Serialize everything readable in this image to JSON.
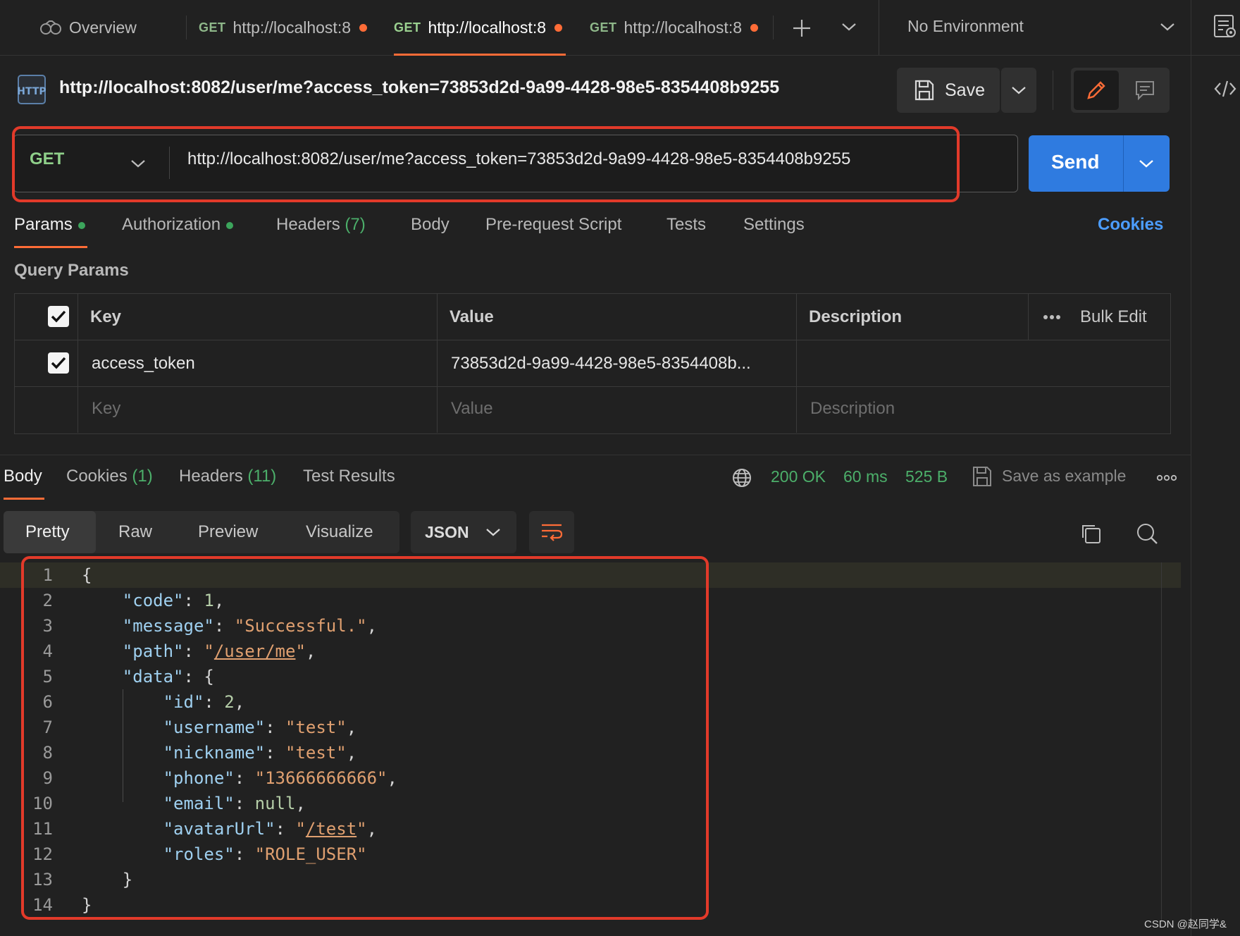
{
  "tabs": {
    "overview": "Overview",
    "items": [
      {
        "method": "GET",
        "label": "http://localhost:8"
      },
      {
        "method": "GET",
        "label": "http://localhost:8"
      },
      {
        "method": "GET",
        "label": "http://localhost:8"
      }
    ],
    "environment": "No Environment"
  },
  "request": {
    "title": "http://localhost:8082/user/me?access_token=73853d2d-9a99-4428-98e5-8354408b9255",
    "save_label": "Save",
    "method": "GET",
    "url": "http://localhost:8082/user/me?access_token=73853d2d-9a99-4428-98e5-8354408b9255",
    "send_label": "Send"
  },
  "request_tabs": {
    "params": "Params",
    "authorization": "Authorization",
    "headers": "Headers",
    "headers_count": "(7)",
    "body": "Body",
    "prerequest": "Pre-request Script",
    "tests": "Tests",
    "settings": "Settings",
    "cookies": "Cookies"
  },
  "query_params": {
    "section_title": "Query Params",
    "headers": {
      "key": "Key",
      "value": "Value",
      "description": "Description",
      "bulk_edit": "Bulk Edit"
    },
    "rows": [
      {
        "key": "access_token",
        "value": "73853d2d-9a99-4428-98e5-8354408b..."
      }
    ],
    "placeholders": {
      "key": "Key",
      "value": "Value",
      "description": "Description"
    }
  },
  "response": {
    "tabs": {
      "body": "Body",
      "cookies": "Cookies",
      "cookies_count": "(1)",
      "headers": "Headers",
      "headers_count": "(11)",
      "test_results": "Test Results"
    },
    "status": "200 OK",
    "time": "60 ms",
    "size": "525 B",
    "save_example": "Save as example",
    "views": {
      "pretty": "Pretty",
      "raw": "Raw",
      "preview": "Preview",
      "visualize": "Visualize"
    },
    "format": "JSON",
    "line_numbers": [
      "1",
      "2",
      "3",
      "4",
      "5",
      "6",
      "7",
      "8",
      "9",
      "10",
      "11",
      "12",
      "13",
      "14"
    ],
    "json": {
      "code_key": "\"code\"",
      "code_val": "1",
      "message_key": "\"message\"",
      "message_val": "\"Successful.\"",
      "path_key": "\"path\"",
      "path_val": "/user/me",
      "data_key": "\"data\"",
      "id_key": "\"id\"",
      "id_val": "2",
      "username_key": "\"username\"",
      "username_val": "\"test\"",
      "nickname_key": "\"nickname\"",
      "nickname_val": "\"test\"",
      "phone_key": "\"phone\"",
      "phone_val": "\"13666666666\"",
      "email_key": "\"email\"",
      "email_val": "null",
      "avatar_key": "\"avatarUrl\"",
      "avatar_val": "/test",
      "roles_key": "\"roles\"",
      "roles_val": "\"ROLE_USER\""
    }
  },
  "watermark": "CSDN @赵同学&",
  "colors": {
    "accent_orange": "#ff6c37",
    "send_blue": "#2f7be0",
    "success_green": "#4caf6a",
    "highlight_red": "#e23a2a"
  }
}
